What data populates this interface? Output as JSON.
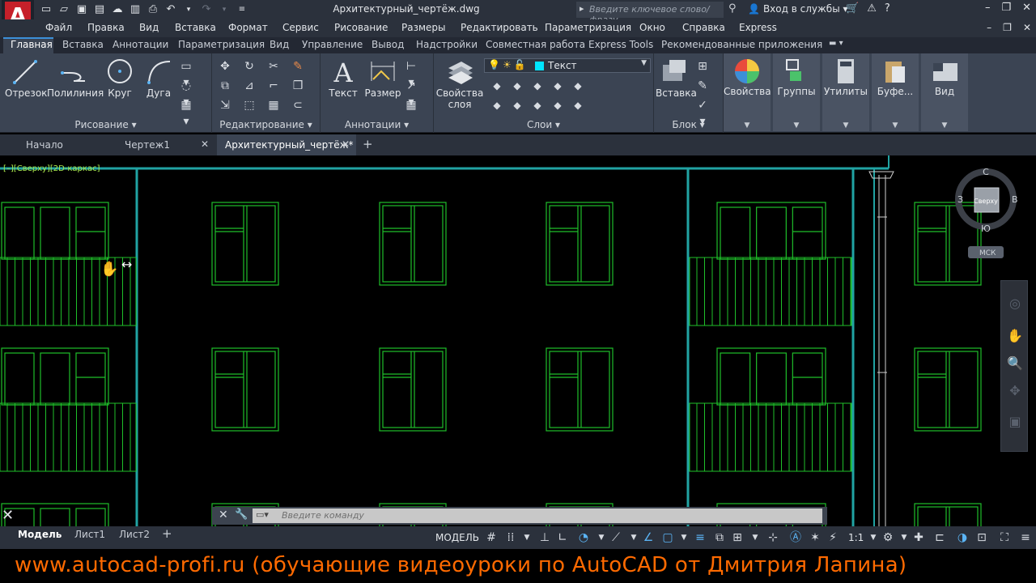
{
  "titlebar": {
    "doc_title": "Архитектурный_чертёж.dwg",
    "search_placeholder": "Введите ключевое слово/фразу",
    "signin": "Вход в службы"
  },
  "menubar": {
    "items": [
      "Файл",
      "Правка",
      "Вид",
      "Вставка",
      "Формат",
      "Сервис",
      "Рисование",
      "Размеры",
      "Редактировать",
      "Параметризация",
      "Окно",
      "Справка",
      "Express"
    ]
  },
  "ribbon_tabs": [
    "Главная",
    "Вставка",
    "Аннотации",
    "Параметризация",
    "Вид",
    "Управление",
    "Вывод",
    "Надстройки",
    "Совместная работа",
    "Express Tools",
    "Рекомендованные приложения"
  ],
  "ribbon": {
    "draw": {
      "title": "Рисование",
      "line": "Отрезок",
      "polyline": "Полилиния",
      "circle": "Круг",
      "arc": "Дуга"
    },
    "modify": {
      "title": "Редактирование"
    },
    "annotation": {
      "title": "Аннотации",
      "text": "Текст",
      "dimension": "Размер"
    },
    "layers": {
      "title": "Слои",
      "properties_line1": "Свойства",
      "properties_line2": "слоя",
      "current_layer": "Текст",
      "current_layer_color": "#00e5ff"
    },
    "block": {
      "title": "Блок",
      "insert": "Вставка"
    },
    "properties": "Свойства",
    "groups": "Группы",
    "utilities": "Утилиты",
    "clipboard": "Буфе...",
    "view": "Вид"
  },
  "doc_tabs": [
    {
      "label": "Начало",
      "closable": false,
      "active": false
    },
    {
      "label": "Чертеж1",
      "closable": true,
      "active": false
    },
    {
      "label": "Архитектурный_чертёж*",
      "closable": true,
      "active": true
    }
  ],
  "viewport_label": "[–][Сверху][2D-каркас]",
  "viewcube": {
    "north": "С",
    "south": "Ю",
    "west": "З",
    "east": "В",
    "face": "Сверху",
    "ucs": "МСК"
  },
  "command_line": {
    "placeholder": "Введите команду"
  },
  "layout_tabs": [
    "Модель",
    "Лист1",
    "Лист2"
  ],
  "status": {
    "model": "МОДЕЛЬ",
    "scale": "1:1"
  },
  "watermark": "www.autocad-profi.ru  (обучающие видеоуроки по AutoCAD от Дмитрия Лапина)",
  "colors": {
    "drawing_green": "#1fbf2a",
    "wall_cyan": "#21a3a3",
    "watermark_orange": "#ff6a00"
  }
}
